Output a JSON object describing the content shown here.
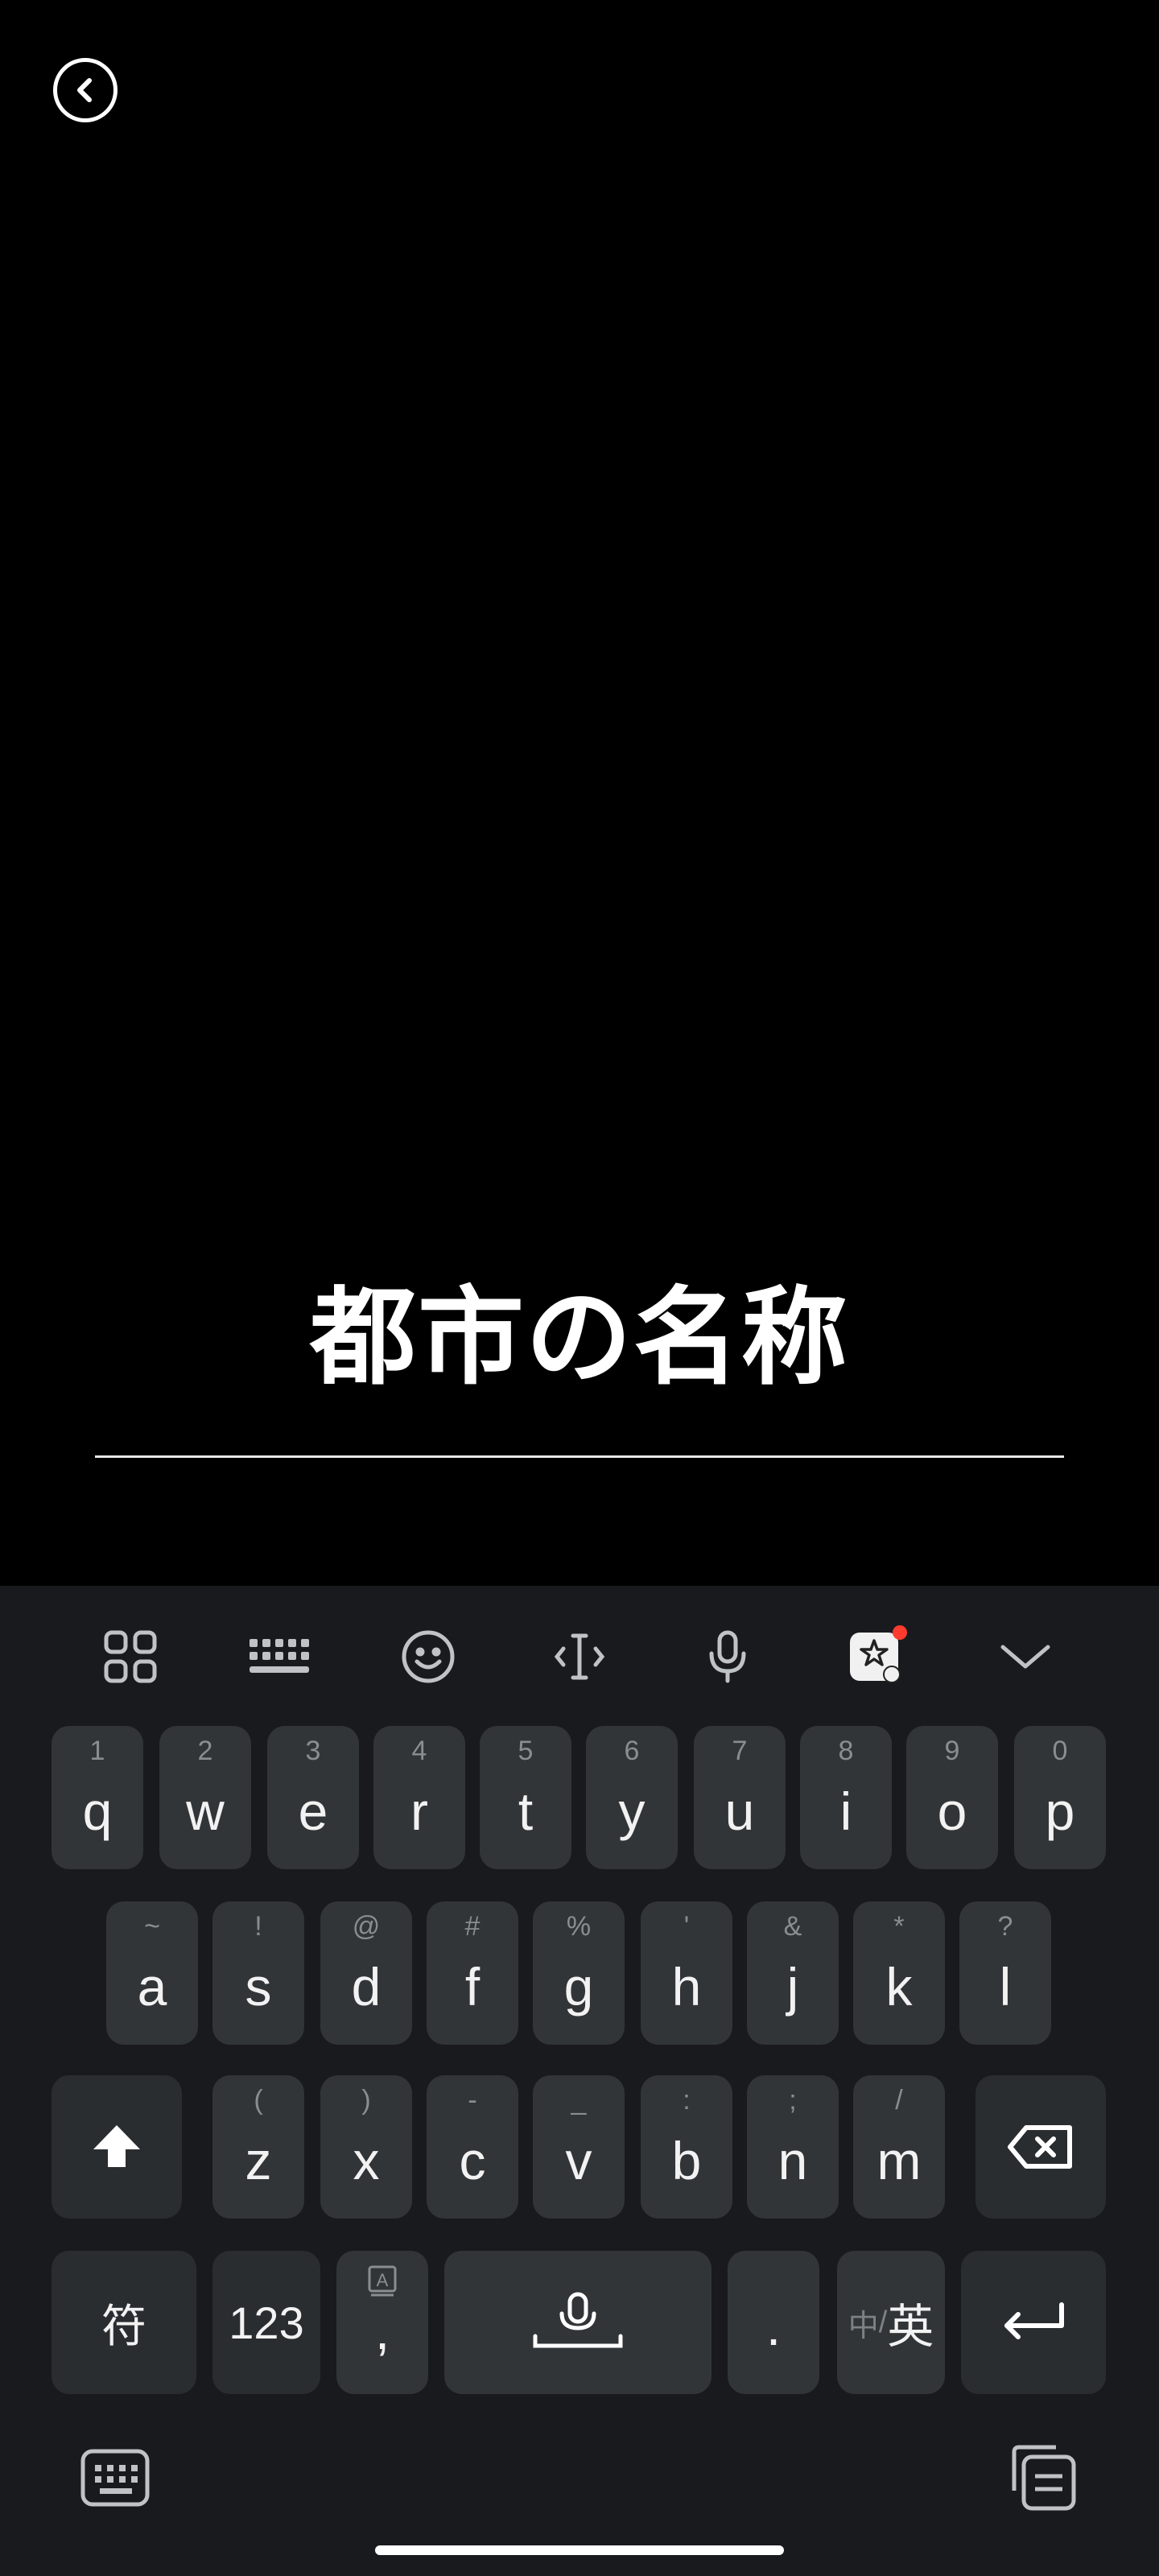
{
  "page": {
    "title": "都市の名称"
  },
  "toolbar": {
    "icons": [
      "apps-grid-icon",
      "keyboard-layout-icon",
      "emoji-icon",
      "cursor-icon",
      "microphone-icon",
      "sticker-icon",
      "collapse-icon"
    ]
  },
  "keyboard": {
    "row1": [
      {
        "key": "q",
        "hint": "1"
      },
      {
        "key": "w",
        "hint": "2"
      },
      {
        "key": "e",
        "hint": "3"
      },
      {
        "key": "r",
        "hint": "4"
      },
      {
        "key": "t",
        "hint": "5"
      },
      {
        "key": "y",
        "hint": "6"
      },
      {
        "key": "u",
        "hint": "7"
      },
      {
        "key": "i",
        "hint": "8"
      },
      {
        "key": "o",
        "hint": "9"
      },
      {
        "key": "p",
        "hint": "0"
      }
    ],
    "row2": [
      {
        "key": "a",
        "hint": "~"
      },
      {
        "key": "s",
        "hint": "!"
      },
      {
        "key": "d",
        "hint": "@"
      },
      {
        "key": "f",
        "hint": "#"
      },
      {
        "key": "g",
        "hint": "%"
      },
      {
        "key": "h",
        "hint": "'"
      },
      {
        "key": "j",
        "hint": "&"
      },
      {
        "key": "k",
        "hint": "*"
      },
      {
        "key": "l",
        "hint": "?"
      }
    ],
    "row3": [
      {
        "key": "z",
        "hint": "("
      },
      {
        "key": "x",
        "hint": ")"
      },
      {
        "key": "c",
        "hint": "-"
      },
      {
        "key": "v",
        "hint": "_"
      },
      {
        "key": "b",
        "hint": ":"
      },
      {
        "key": "n",
        "hint": ";"
      },
      {
        "key": "m",
        "hint": "/"
      }
    ],
    "symbols_label": "符",
    "numbers_label": "123",
    "comma_label": ",",
    "period_label": ".",
    "lang_label_zh": "中",
    "lang_sep": "/",
    "lang_label_en": "英"
  },
  "colors": {
    "background": "#000000",
    "keyboard_bg": "#181a1d",
    "key_bg": "#323538",
    "notification_dot": "#ff3b30"
  }
}
